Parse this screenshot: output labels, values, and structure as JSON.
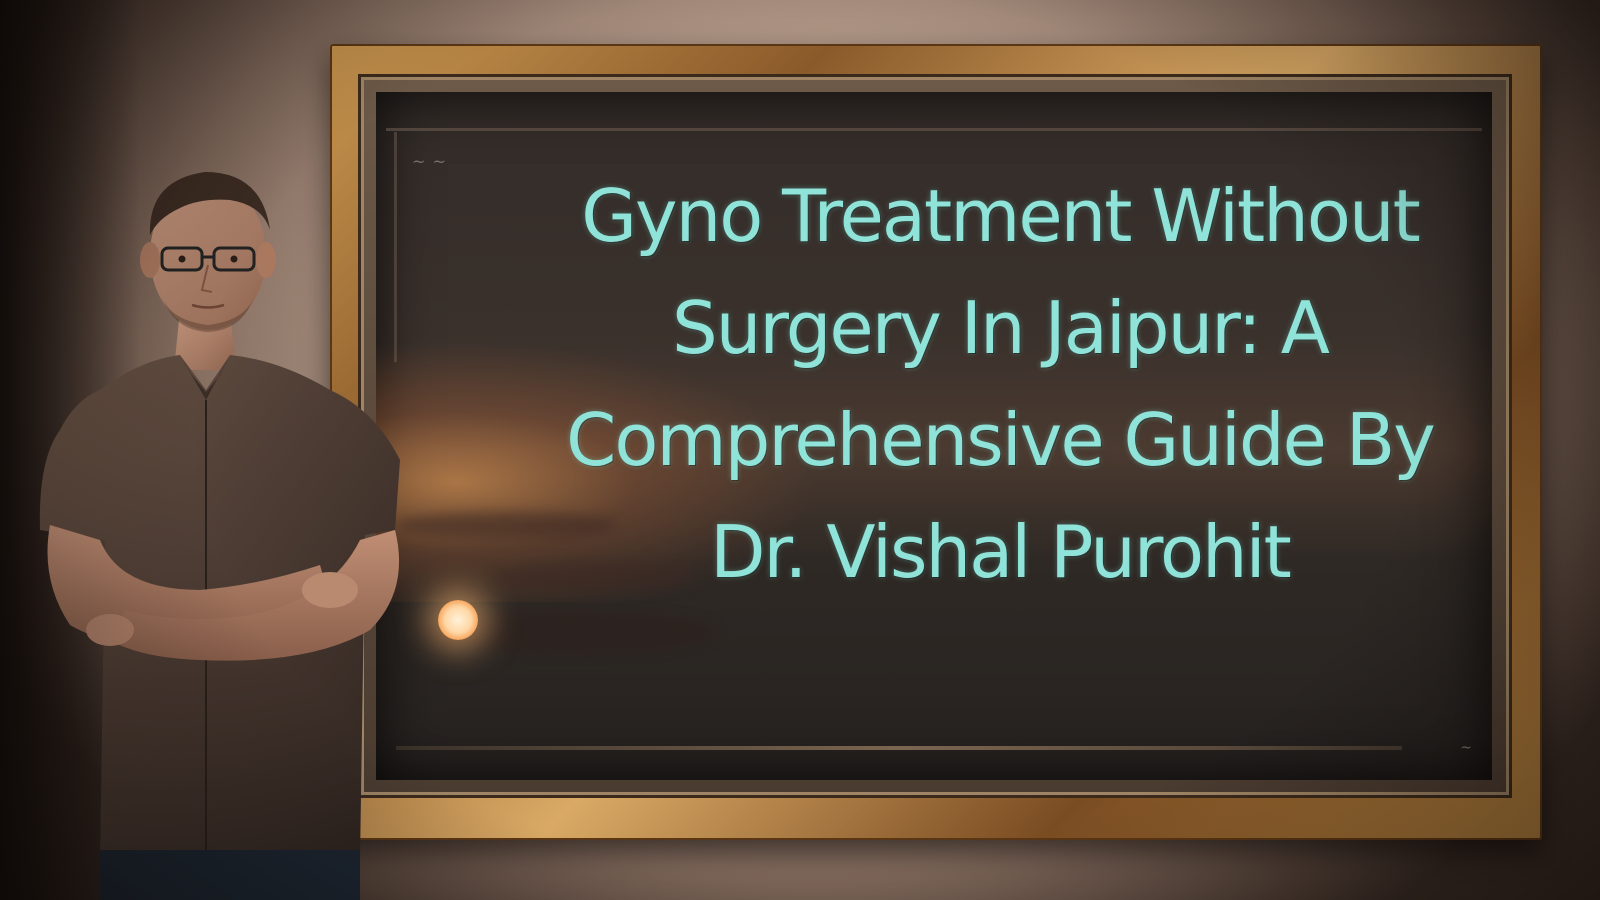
{
  "board": {
    "headline": "Gyno Treatment Without Surgery In Jaipur: A Comprehensive Guide By Dr. Vishal Purohit"
  },
  "colors": {
    "headline_text": "#8fe3d8",
    "frame_gold": "#c8964f",
    "board_dark": "#332c29",
    "wall": "#c9b2a2",
    "shirt": "#4a3a32"
  }
}
